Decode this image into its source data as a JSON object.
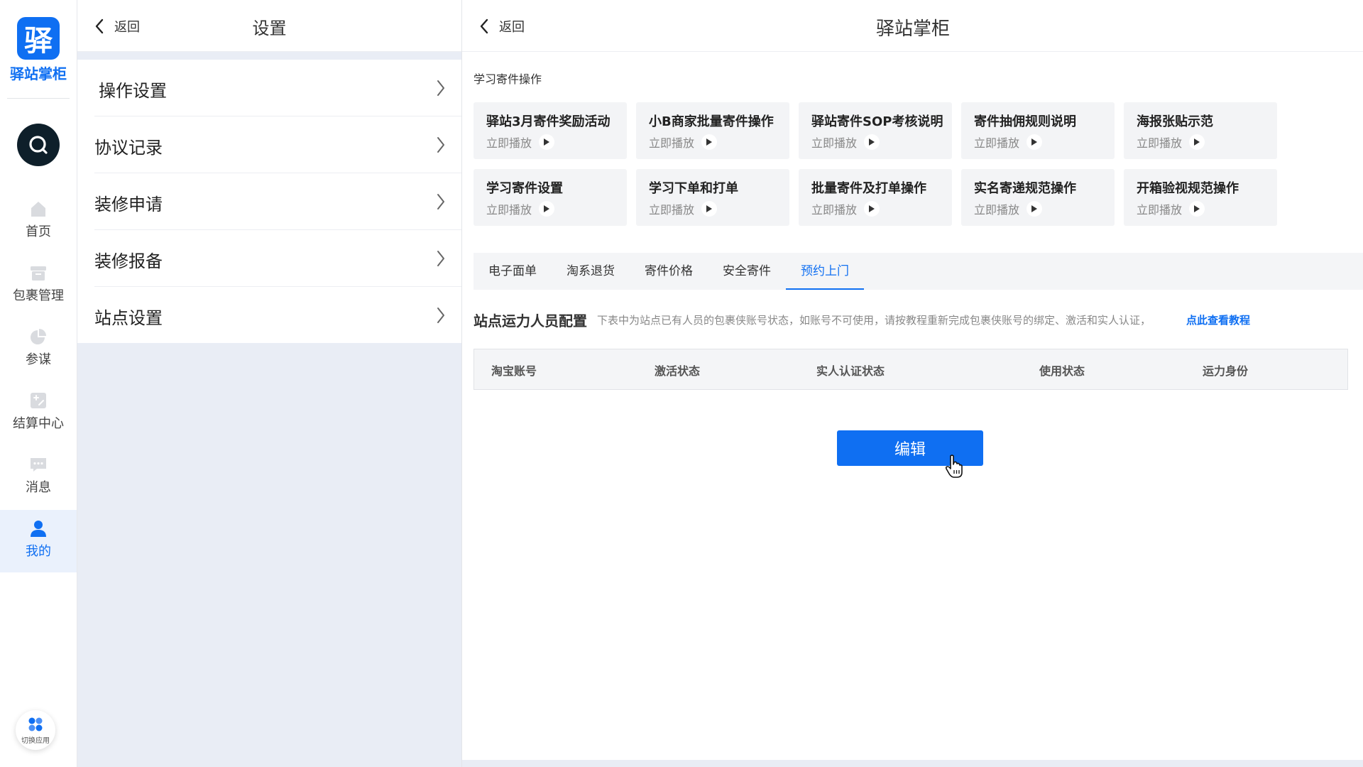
{
  "rail": {
    "logo_char": "驿",
    "logo_text": "驿站掌柜",
    "items": [
      {
        "label": "首页",
        "icon": "home-icon"
      },
      {
        "label": "包裹管理",
        "icon": "package-icon"
      },
      {
        "label": "参谋",
        "icon": "pie-chart-icon"
      },
      {
        "label": "结算中心",
        "icon": "settlement-icon"
      },
      {
        "label": "消息",
        "icon": "message-icon"
      },
      {
        "label": "我的",
        "icon": "user-icon",
        "active": true
      }
    ],
    "switch_app": "切换应用"
  },
  "settings": {
    "back": "返回",
    "title": "设置",
    "items": [
      "操作设置",
      "协议记录",
      "装修申请",
      "装修报备",
      "站点设置"
    ]
  },
  "main": {
    "back": "返回",
    "title": "驿站掌柜",
    "section_label": "学习寄件操作",
    "play_label": "立即播放",
    "cards": [
      "驿站3月寄件奖励活动",
      "小B商家批量寄件操作",
      "驿站寄件SOP考核说明",
      "寄件抽佣规则说明",
      "海报张贴示范",
      "学习寄件设置",
      "学习下单和打单",
      "批量寄件及打单操作",
      "实名寄递规范操作",
      "开箱验视规范操作"
    ],
    "tabs": [
      "电子面单",
      "淘系退货",
      "寄件价格",
      "安全寄件",
      "预约上门"
    ],
    "active_tab": "预约上门",
    "config_title": "站点运力人员配置",
    "config_desc": "下表中为站点已有人员的包裹侠账号状态，如账号不可使用，请按教程重新完成包裹侠账号的绑定、激活和实人认证，",
    "config_link": "点此查看教程",
    "table_headers": [
      "淘宝账号",
      "激活状态",
      "实人认证状态",
      "使用状态",
      "运力身份"
    ],
    "edit_button": "编辑"
  },
  "colors": {
    "accent": "#0f6ff2",
    "panel_bg": "#e9edf5",
    "card_bg": "#f3f4f6"
  }
}
